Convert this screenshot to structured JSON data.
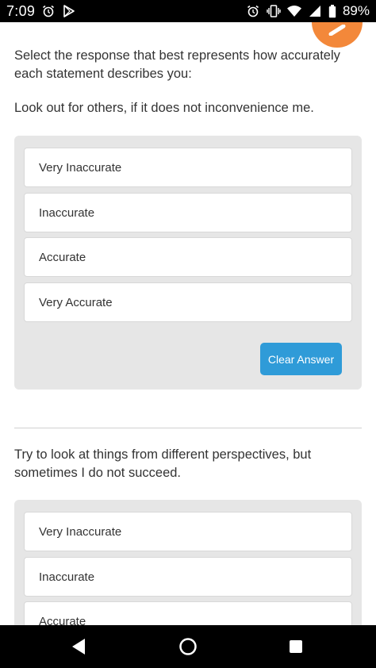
{
  "status_bar": {
    "time": "7:09",
    "battery": "89%",
    "left_icons": [
      "alarm-icon",
      "play-store-icon"
    ],
    "right_icons": [
      "alarm-icon",
      "vibrate-icon",
      "wifi-icon",
      "signal-icon",
      "battery-icon"
    ]
  },
  "survey": {
    "instructions": "Select the response that best represents how accurately each statement describes you:",
    "questions": [
      {
        "statement": "Look out for others, if it does not inconvenience me.",
        "options": [
          "Very Inaccurate",
          "Inaccurate",
          "Accurate",
          "Very Accurate"
        ],
        "clear_label": "Clear Answer"
      },
      {
        "statement": "Try to look at things from different perspectives, but sometimes I do not succeed.",
        "options": [
          "Very Inaccurate",
          "Inaccurate",
          "Accurate"
        ]
      }
    ]
  },
  "nav_bar": {
    "buttons": [
      "back-icon",
      "home-icon",
      "recents-icon"
    ]
  },
  "colors": {
    "accent_button": "#2f9bd8",
    "fab": "#f3883a",
    "panel_background": "#e6e6e6"
  }
}
